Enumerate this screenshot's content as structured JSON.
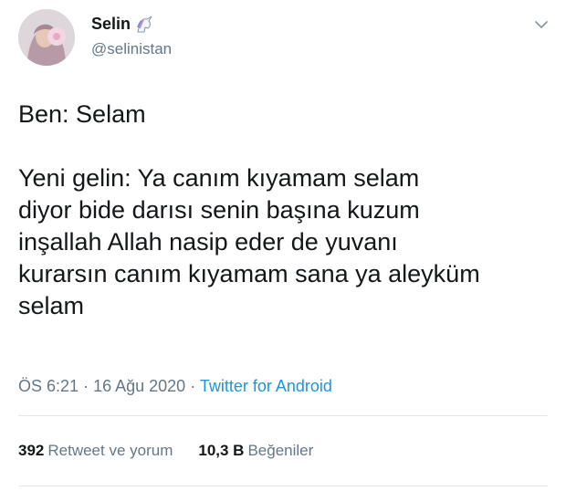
{
  "user": {
    "display_name": "Selin",
    "name_emoji": "unicorn-icon",
    "handle": "@selinistan"
  },
  "tweet": {
    "lines": "Ben: Selam\n\nYeni gelin: Ya canım kıyamam selam\ndiyor bide darısı senin başına kuzum\ninşallah Allah nasip eder de yuvanı\nkurarsın canım kıyamam sana ya aleyküm\nselam",
    "time": "ÖS 6:21",
    "date": "16 Ağu 2020",
    "source": "Twitter for Android"
  },
  "stats": {
    "retweets_count": "392",
    "retweets_label": "Retweet ve yorum",
    "likes_count": "10,3 B",
    "likes_label": "Beğeniler"
  },
  "colors": {
    "link": "#1b95e0",
    "secondary_text": "#657786",
    "primary_text": "#14171a",
    "divider": "#e1e8ed"
  }
}
